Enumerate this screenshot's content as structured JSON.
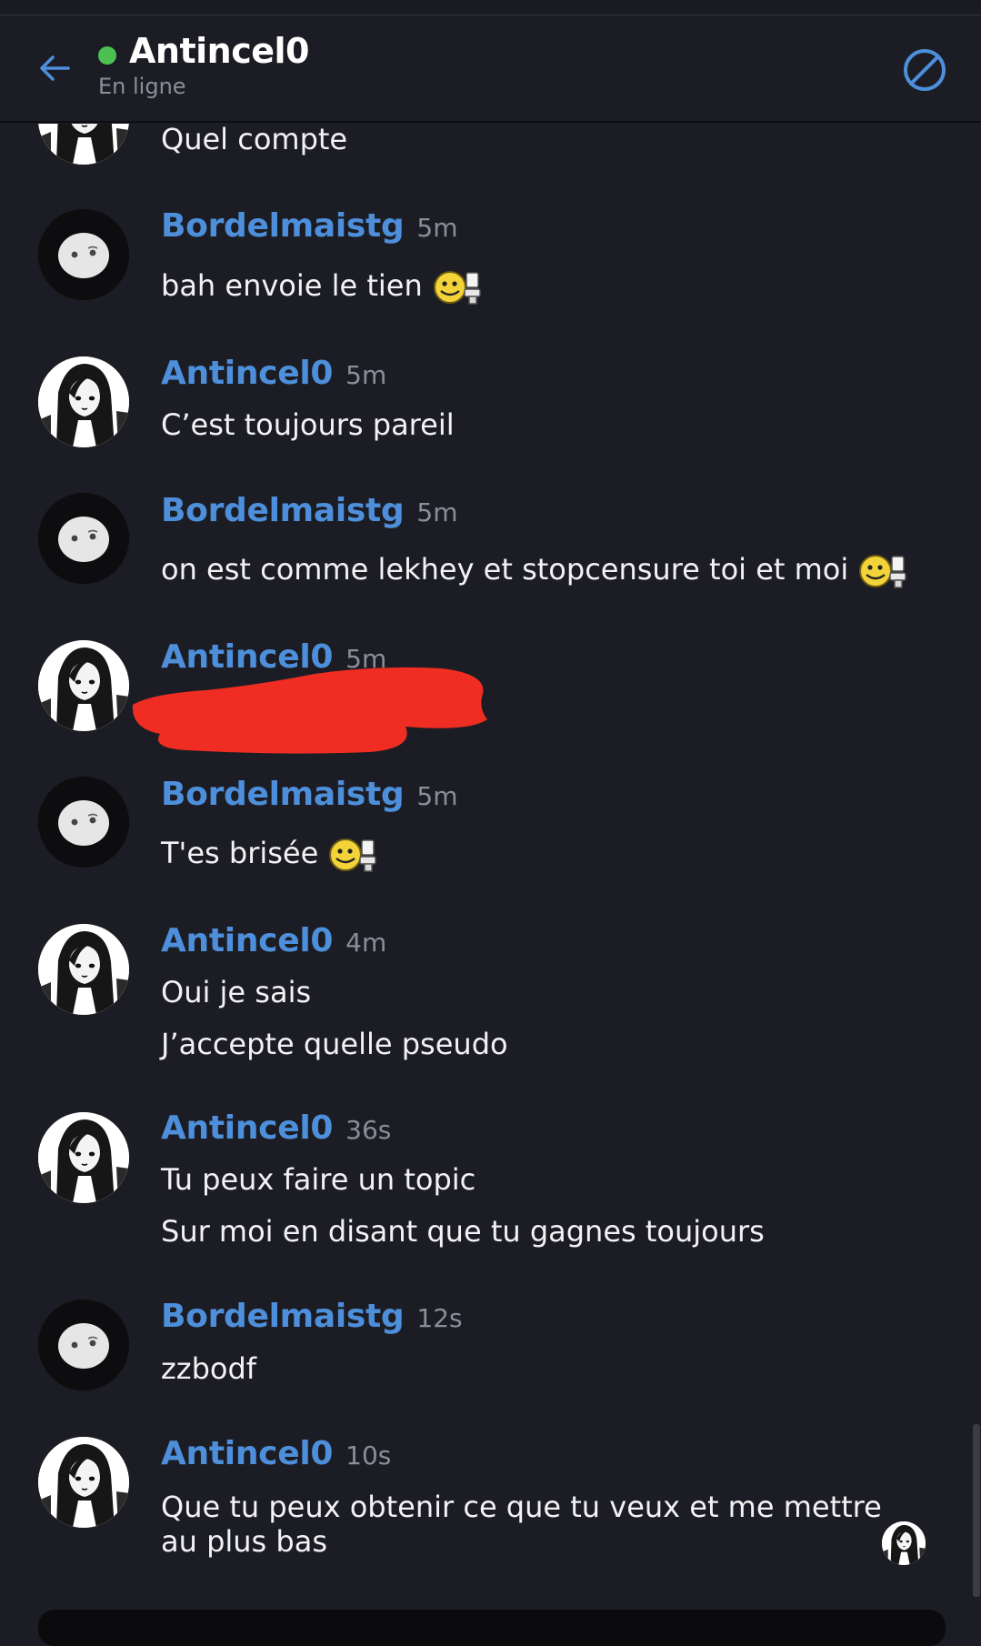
{
  "header": {
    "title": "Antincel0",
    "status": "En ligne",
    "status_color": "#4cc152"
  },
  "colors": {
    "accent": "#4d8fdb",
    "background": "#1c1d24",
    "text": "#f2f2f4",
    "muted": "#8b8e98"
  },
  "messages": [
    {
      "user": "",
      "time": "",
      "lines": [
        "Quel compte"
      ],
      "avatar": "girl-avatar"
    },
    {
      "user": "Bordelmaistg",
      "time": "5m",
      "lines": [
        "bah envoie le tien"
      ],
      "avatar": "blob-avatar",
      "emoji": "sticker-smiley-toilet-icon"
    },
    {
      "user": "Antincel0",
      "time": "5m",
      "lines": [
        "C’est toujours pareil"
      ],
      "avatar": "girl-avatar"
    },
    {
      "user": "Bordelmaistg",
      "time": "5m",
      "lines": [
        "on est comme lekhey et stopcensure toi et moi"
      ],
      "avatar": "blob-avatar",
      "emoji": "sticker-smiley-toilet-icon"
    },
    {
      "user": "Antincel0",
      "time": "5m",
      "lines": [],
      "avatar": "girl-avatar",
      "redacted": true
    },
    {
      "user": "Bordelmaistg",
      "time": "5m",
      "lines": [
        "T'es brisée"
      ],
      "avatar": "blob-avatar",
      "emoji": "sticker-smiley-toilet-icon"
    },
    {
      "user": "Antincel0",
      "time": "4m",
      "lines": [
        "Oui je sais",
        "J’accepte quelle pseudo"
      ],
      "avatar": "girl-avatar"
    },
    {
      "user": "Antincel0",
      "time": "36s",
      "lines": [
        "Tu peux faire un topic",
        "Sur moi en disant que tu gagnes toujours"
      ],
      "avatar": "girl-avatar"
    },
    {
      "user": "Bordelmaistg",
      "time": "12s",
      "lines": [
        "zzbodf"
      ],
      "avatar": "blob-avatar"
    },
    {
      "user": "Antincel0",
      "time": "10s",
      "lines": [
        "Que tu peux obtenir ce que tu veux et me mettre au plus bas"
      ],
      "avatar": "girl-avatar"
    }
  ]
}
